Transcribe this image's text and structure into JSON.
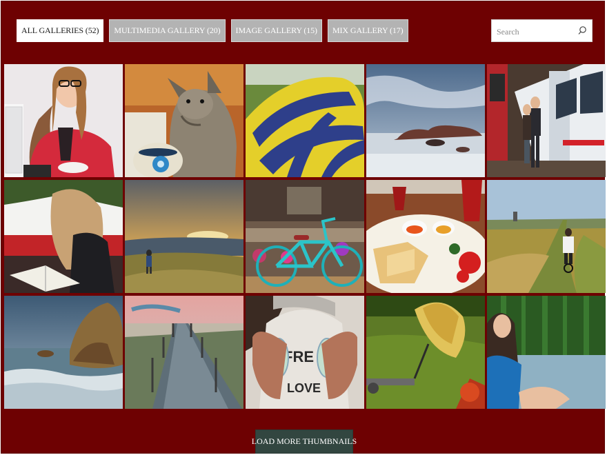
{
  "filters": [
    {
      "label": "ALL GALLERIES (52)",
      "active": true
    },
    {
      "label": "MULTIMEDIA GALLERY (20)",
      "active": false
    },
    {
      "label": "IMAGE GALLERY (15)",
      "active": false
    },
    {
      "label": "MIX GALLERY (17)",
      "active": false
    }
  ],
  "search": {
    "placeholder": "Search",
    "icon": "search-icon"
  },
  "thumbnails": [
    {
      "subject": "woman-at-laptop"
    },
    {
      "subject": "kitten-with-teacup"
    },
    {
      "subject": "hot-air-balloon-fabric"
    },
    {
      "subject": "rocky-seashore"
    },
    {
      "subject": "couple-by-tram"
    },
    {
      "subject": "woman-reading-book"
    },
    {
      "subject": "hiker-at-sunset"
    },
    {
      "subject": "turquoise-bicycle"
    },
    {
      "subject": "breakfast-table"
    },
    {
      "subject": "cyclist-on-field-path"
    },
    {
      "subject": "sea-rocks-waves"
    },
    {
      "subject": "wooden-boardwalk"
    },
    {
      "subject": "hands-holding-headphones"
    },
    {
      "subject": "straw-hat-on-grass"
    },
    {
      "subject": "woman-by-lake"
    }
  ],
  "load_more": {
    "label": "LOAD MORE THUMBNAILS"
  },
  "colors": {
    "background": "#6e0102",
    "active_filter": "#ffffff",
    "inactive_filter": "#b3b3b3",
    "load_more": "#324640"
  }
}
